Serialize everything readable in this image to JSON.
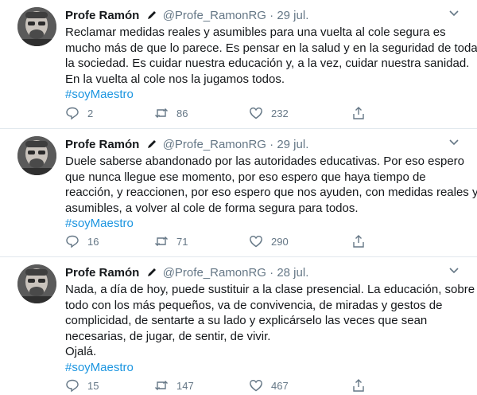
{
  "tweets": [
    {
      "author": "Profe Ramón",
      "handle": "@Profe_RamonRG",
      "separator": "·",
      "date": "29 jul.",
      "lines": [
        "Reclamar medidas reales y asumibles para una vuelta al cole segura es",
        "mucho más de que lo parece. Es pensar en la salud y en la seguridad de toda",
        "la sociedad. Es cuidar nuestra educación y, a la vez, cuidar nuestra sanidad.",
        "En la vuelta al cole nos la jugamos todos."
      ],
      "hashtag": "#soyMaestro",
      "replies": "2",
      "retweets": "86",
      "likes": "232"
    },
    {
      "author": "Profe Ramón",
      "handle": "@Profe_RamonRG",
      "separator": "·",
      "date": "29 jul.",
      "lines": [
        "Duele saberse abandonado por las autoridades educativas. Por eso espero",
        "que nunca llegue ese momento, por eso espero que haya tiempo de",
        "reacción, y reaccionen, por eso espero que nos ayuden, con medidas reales y",
        "asumibles, a volver al cole de forma segura para todos."
      ],
      "hashtag": "#soyMaestro",
      "replies": "16",
      "retweets": "71",
      "likes": "290"
    },
    {
      "author": "Profe Ramón",
      "handle": "@Profe_RamonRG",
      "separator": "·",
      "date": "28 jul.",
      "lines": [
        "Nada, a día de hoy, puede sustituir a la clase presencial. La educación, sobre",
        "todo con los más pequeños, va de convivencia, de miradas y gestos de",
        "complicidad, de sentarte a su lado y explicárselo las veces que sean",
        "necesarias, de jugar, de sentir, de vivir.",
        "Ojalá."
      ],
      "hashtag": "#soyMaestro",
      "replies": "15",
      "retweets": "147",
      "likes": "467"
    }
  ],
  "icons": {
    "reply": "reply-icon",
    "retweet": "retweet-icon",
    "like": "heart-icon",
    "share": "share-icon",
    "more": "chevron-down-icon",
    "verified_badge": "pencil-icon"
  },
  "colors": {
    "text": "#14171a",
    "secondary": "#657786",
    "link": "#1b95e0",
    "border": "#e1e8ed"
  }
}
